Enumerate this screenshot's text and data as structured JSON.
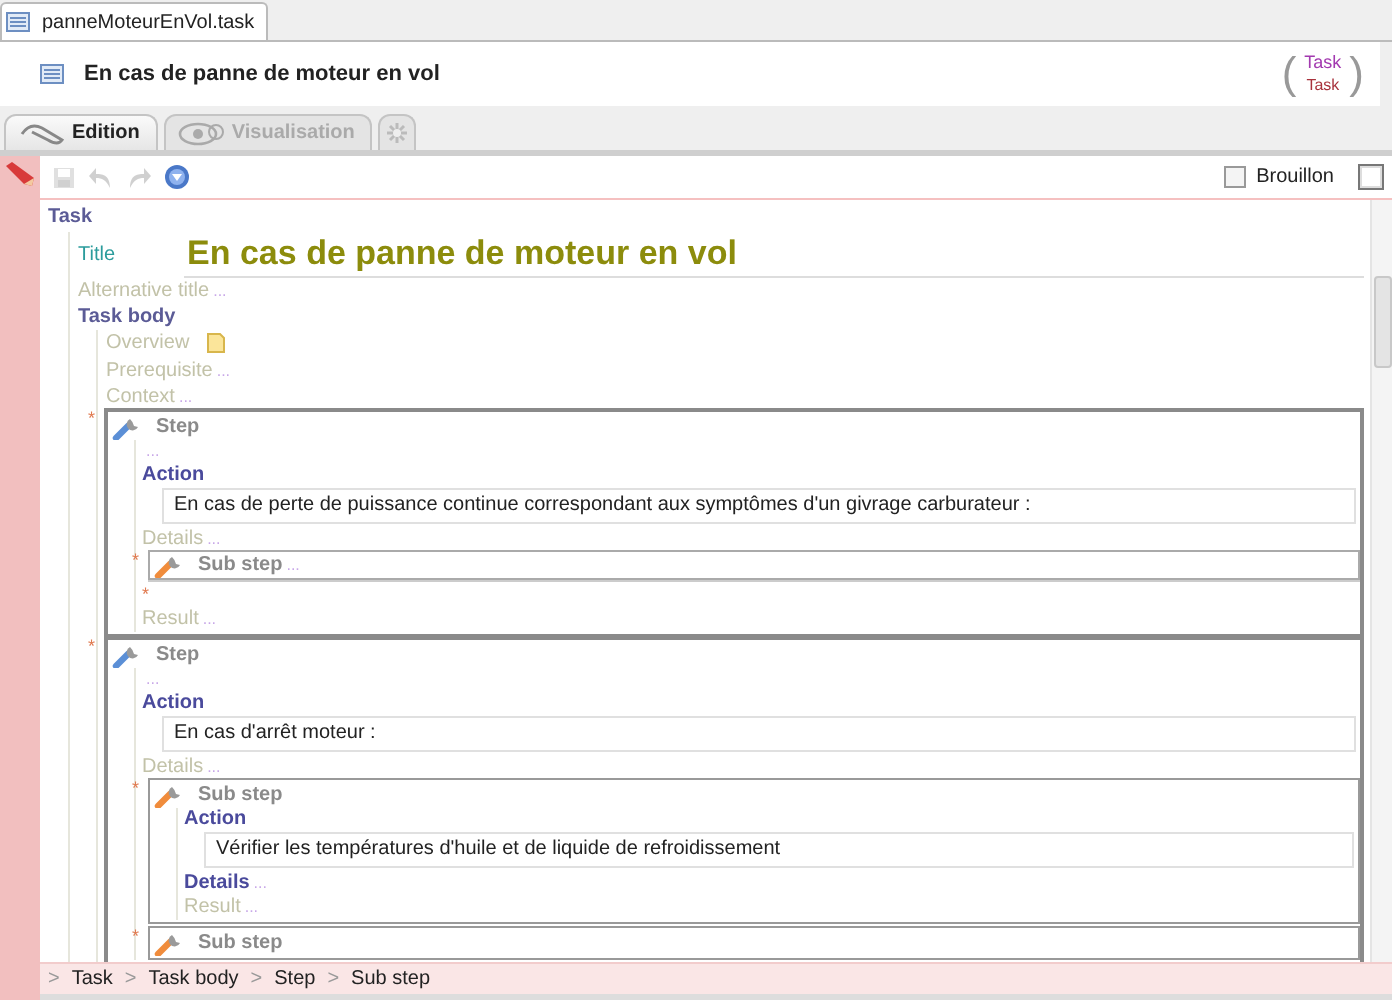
{
  "file_tab": {
    "label": "panneMoteurEnVol.task",
    "selected": true
  },
  "header": {
    "title": "En cas de panne de moteur en vol",
    "open_paren": "(",
    "type_top": "Task",
    "type_bottom": "Task",
    "close_paren": ")"
  },
  "view_tabs": [
    {
      "kind": "edition",
      "label": "Edition",
      "selected": true
    },
    {
      "kind": "visualisation",
      "label": "Visualisation",
      "selected": false
    },
    {
      "kind": "settings",
      "selected": false
    }
  ],
  "toolbar": {
    "buttons": [
      {
        "kind": "save",
        "disabled": true
      },
      {
        "kind": "undo",
        "disabled": true
      },
      {
        "kind": "redo",
        "disabled": true
      },
      {
        "kind": "validate",
        "disabled": false
      }
    ],
    "draft": {
      "label": "Brouillon",
      "checked": false
    }
  },
  "document": {
    "label": "Task",
    "children": [
      {
        "kind": "title",
        "label": "Title",
        "text": "En cas de panne de moteur en vol"
      },
      {
        "kind": "field",
        "label": "Alternative title",
        "ellipsis": "...",
        "filled": false
      },
      {
        "kind": "section",
        "label": "Task body",
        "children": [
          {
            "kind": "note-field",
            "label": "Overview",
            "filled": false
          },
          {
            "kind": "field",
            "label": "Prerequisite",
            "ellipsis": "...",
            "filled": false
          },
          {
            "kind": "field",
            "label": "Context",
            "ellipsis": "...",
            "filled": false
          },
          {
            "kind": "step",
            "marker": "*",
            "label": "Step",
            "collapsed": false,
            "children": [
              {
                "kind": "ellipsis",
                "text": "..."
              },
              {
                "kind": "action",
                "label": "Action",
                "text": "En cas de perte de puissance continue correspondant aux symptômes d'un givrage carburateur :"
              },
              {
                "kind": "field",
                "label": "Details",
                "ellipsis": "...",
                "filled": false
              },
              {
                "kind": "substep",
                "marker": "*",
                "label": "Sub step",
                "ellipsis": "...",
                "collapsed": true
              },
              {
                "kind": "marker",
                "text": "*"
              },
              {
                "kind": "field",
                "label": "Result",
                "ellipsis": "...",
                "filled": false
              }
            ]
          },
          {
            "kind": "step",
            "marker": "*",
            "label": "Step",
            "collapsed": false,
            "children": [
              {
                "kind": "ellipsis",
                "text": "..."
              },
              {
                "kind": "action",
                "label": "Action",
                "text": "En cas d'arrêt moteur :"
              },
              {
                "kind": "field",
                "label": "Details",
                "ellipsis": "...",
                "filled": false
              },
              {
                "kind": "substep",
                "marker": "*",
                "label": "Sub step",
                "collapsed": false,
                "children": [
                  {
                    "kind": "action",
                    "label": "Action",
                    "text": "Vérifier les températures d'huile et de liquide de refroidissement"
                  },
                  {
                    "kind": "field",
                    "label": "Details",
                    "ellipsis": "...",
                    "filled": true
                  },
                  {
                    "kind": "field",
                    "label": "Result",
                    "ellipsis": "...",
                    "filled": false
                  }
                ]
              },
              {
                "kind": "substep",
                "marker": "*",
                "label": "Sub step",
                "collapsed": false
              }
            ]
          }
        ]
      }
    ]
  },
  "breadcrumb": [
    {
      "separator": ">",
      "label": "Task"
    },
    {
      "separator": ">",
      "label": "Task body"
    },
    {
      "separator": ">",
      "label": "Step"
    },
    {
      "separator": ">",
      "label": "Sub step"
    }
  ]
}
